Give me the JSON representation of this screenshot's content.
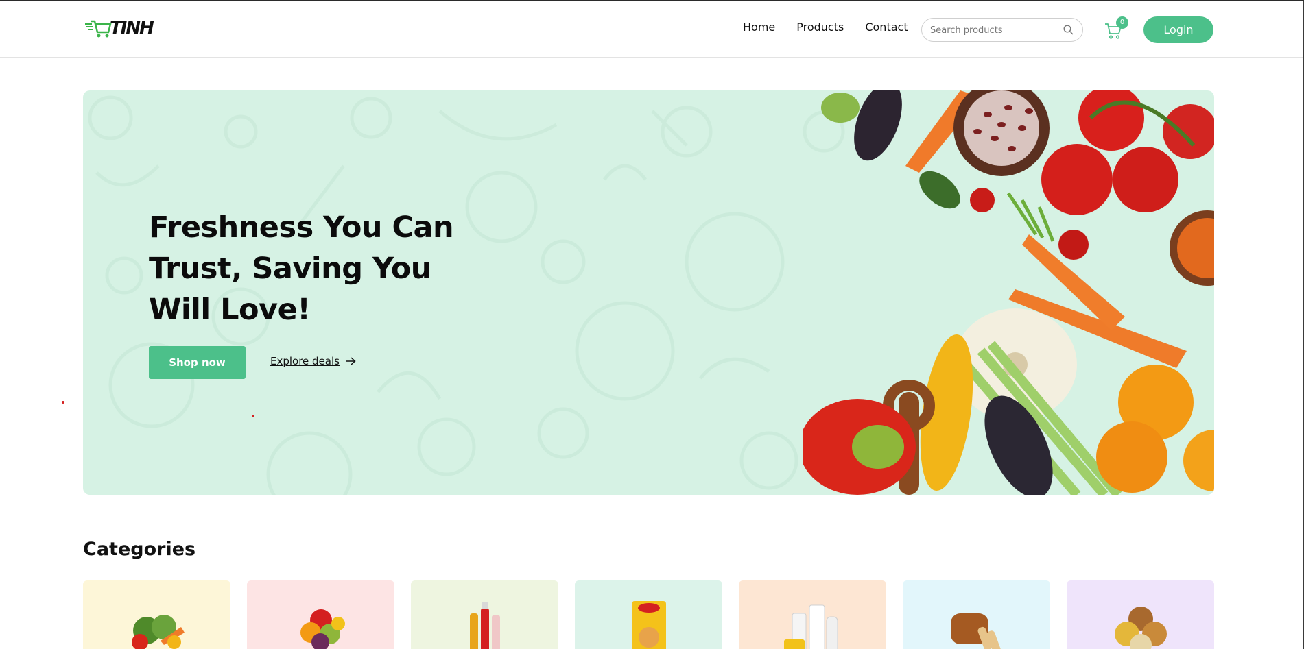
{
  "header": {
    "logo_text": "TINH",
    "nav": [
      {
        "label": "Home"
      },
      {
        "label": "Products"
      },
      {
        "label": "Contact"
      }
    ],
    "search": {
      "placeholder": "Search products",
      "icon": "search-icon"
    },
    "cart": {
      "icon": "cart-icon",
      "count": "0"
    },
    "login_label": "Login",
    "accent_color": "#4cc08a"
  },
  "hero": {
    "title": "Freshness You Can Trust, Saving You Will Love!",
    "shop_label": "Shop now",
    "deals_label": "Explore deals",
    "deals_icon": "arrow-right-icon",
    "background_color": "#d6f2e4"
  },
  "categories": {
    "title": "Categories",
    "items": [
      {
        "icon": "vegetables-icon",
        "color": "#fdf6d8"
      },
      {
        "icon": "fruits-icon",
        "color": "#fde4e4"
      },
      {
        "icon": "beverages-icon",
        "color": "#eef5e0"
      },
      {
        "icon": "noodles-icon",
        "color": "#dcf3ea"
      },
      {
        "icon": "dairy-icon",
        "color": "#fde6d3"
      },
      {
        "icon": "bread-icon",
        "color": "#e2f6fb"
      },
      {
        "icon": "grains-icon",
        "color": "#efe4fb"
      }
    ]
  }
}
